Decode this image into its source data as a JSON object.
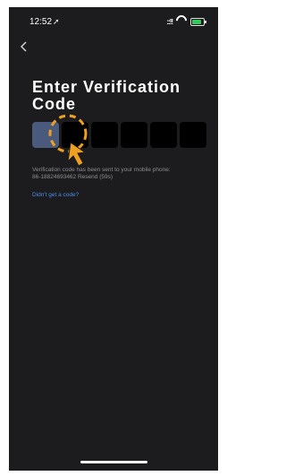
{
  "status_bar": {
    "time": "12:52",
    "location_glyph": "➚",
    "signal_text": "::!!",
    "battery_level": 0.7,
    "battery_color": "#34c759"
  },
  "nav": {
    "back_icon": "chevron-left-icon"
  },
  "title": "Enter Verification Code",
  "code": {
    "boxes": 6,
    "active_index": 0,
    "active_color": "#4a5a7c",
    "filled_color": "#000000"
  },
  "hint": {
    "line1": "Verification code has been sent to your mobile phone:",
    "phone": "86-18824693462",
    "resend": "Resend (59s)"
  },
  "didnt_get_code": "Didn't get a code?",
  "overlay": {
    "highlight_circle_color": "#f0a020",
    "pointer_color": "#f0a020"
  }
}
